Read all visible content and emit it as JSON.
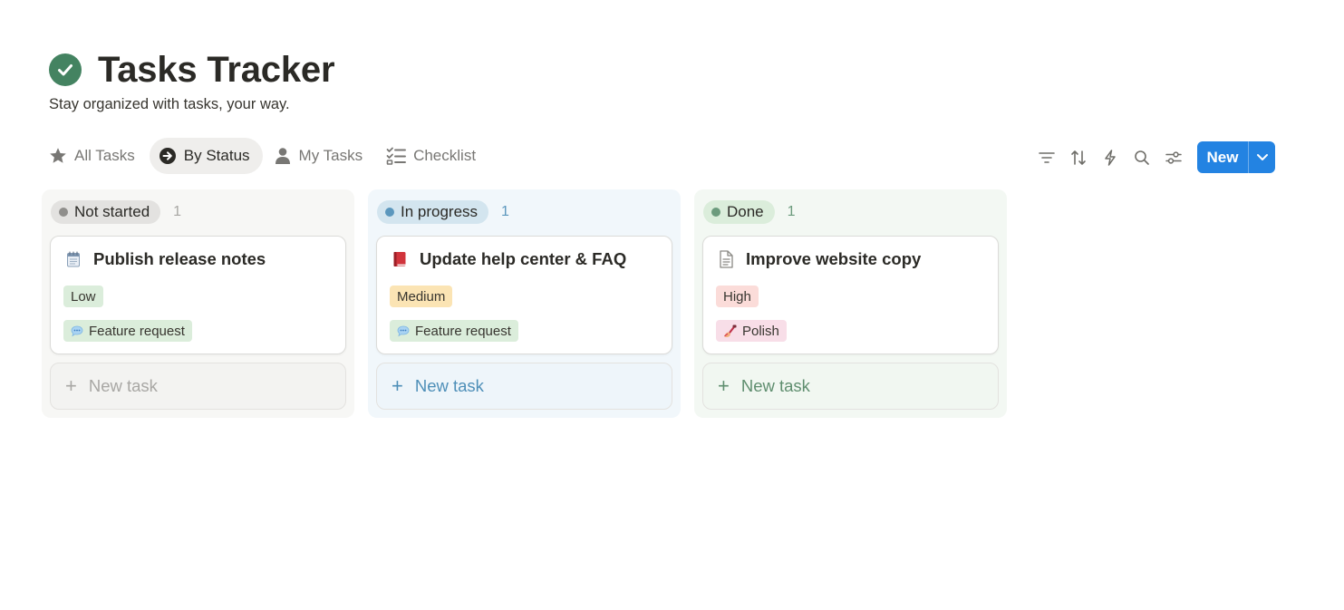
{
  "header": {
    "title": "Tasks Tracker",
    "subtitle": "Stay organized with tasks, your way.",
    "icon": "check-circle-icon"
  },
  "tabs": [
    {
      "label": "All Tasks",
      "icon": "star-icon",
      "active": false
    },
    {
      "label": "By Status",
      "icon": "arrow-circle-icon",
      "active": true
    },
    {
      "label": "My Tasks",
      "icon": "person-icon",
      "active": false
    },
    {
      "label": "Checklist",
      "icon": "checklist-icon",
      "active": false
    }
  ],
  "toolbar": {
    "icons": [
      "filter-icon",
      "sort-icon",
      "automation-icon",
      "search-icon",
      "settings-icon"
    ],
    "new_label": "New"
  },
  "columns": [
    {
      "status": "Not started",
      "count": "1",
      "colors": {
        "bg": "#f7f7f5",
        "pill": "#e3e2e0",
        "dot": "#8f8e8b",
        "count": "#a8a7a4",
        "new_task": "#a8a7a4",
        "new_task_bg": "#f3f3f1"
      },
      "card": {
        "title": "Publish release notes",
        "icon": "notepad-icon",
        "priority": {
          "label": "Low",
          "bg": "#dbeddb"
        },
        "type": {
          "label": "Feature request",
          "icon": "speech-bubble-icon",
          "bg": "#dbeddb"
        }
      },
      "new_task_label": "New task"
    },
    {
      "status": "In progress",
      "count": "1",
      "colors": {
        "bg": "#f1f7fb",
        "pill": "#d3e5ef",
        "dot": "#5b97bd",
        "count": "#5b97bd",
        "new_task": "#4e8fb8",
        "new_task_bg": "#eef5fa"
      },
      "card": {
        "title": "Update help center & FAQ",
        "icon": "red-book-icon",
        "priority": {
          "label": "Medium",
          "bg": "#fbe4b4"
        },
        "type": {
          "label": "Feature request",
          "icon": "speech-bubble-icon",
          "bg": "#dbeddb"
        }
      },
      "new_task_label": "New task"
    },
    {
      "status": "Done",
      "count": "1",
      "colors": {
        "bg": "#f3f8f3",
        "pill": "#dbeddb",
        "dot": "#6c9b7d",
        "count": "#6c9b7d",
        "new_task": "#5f8e6f",
        "new_task_bg": "#f1f7f1"
      },
      "card": {
        "title": "Improve website copy",
        "icon": "document-icon",
        "priority": {
          "label": "High",
          "bg": "#fbdcd9"
        },
        "type": {
          "label": "Polish",
          "icon": "nail-polish-icon",
          "bg": "#f8dee8"
        }
      },
      "new_task_label": "New task"
    }
  ]
}
